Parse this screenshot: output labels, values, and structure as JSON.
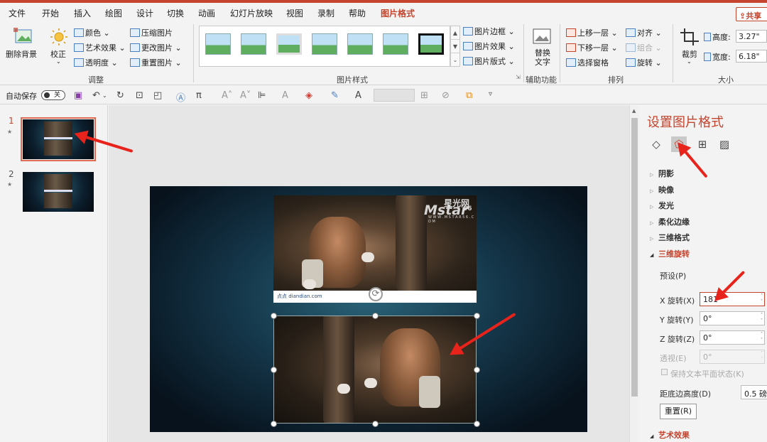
{
  "colors": {
    "accent": "#c4442d",
    "arrow": "#e8231b"
  },
  "menu": {
    "items": [
      "文件",
      "开始",
      "插入",
      "绘图",
      "设计",
      "切换",
      "动画",
      "幻灯片放映",
      "视图",
      "录制",
      "帮助",
      "图片格式"
    ],
    "active": "图片格式",
    "share": "共享"
  },
  "ribbon": {
    "remove_bg": "删除背景",
    "correct": "校正",
    "color": "颜色",
    "artistic": "艺术效果",
    "transparency": "透明度",
    "compress": "压缩图片",
    "change": "更改图片",
    "reset_pic": "重置图片",
    "adjust_label": "调整",
    "styles_label": "图片样式",
    "border": "图片边框",
    "effects": "图片效果",
    "layout": "图片版式",
    "alt_text": "替换文字",
    "accessibility_label": "辅助功能",
    "bring_forward": "上移一层",
    "send_backward": "下移一层",
    "selection_pane": "选择窗格",
    "align": "对齐",
    "group": "组合",
    "rotate": "旋转",
    "arrange_label": "排列",
    "crop": "裁剪",
    "height_label": "高度:",
    "height_value": "3.27\"",
    "width_label": "宽度:",
    "width_value": "6.18\"",
    "size_label": "大小"
  },
  "qat": {
    "autosave": "自动保存",
    "toggle": "关"
  },
  "slides": [
    {
      "number": "1",
      "active": true
    },
    {
      "number": "2",
      "active": false
    }
  ],
  "slide": {
    "watermark_brand": "星光网",
    "watermark_logo": "Mstar",
    "watermark_num": "56",
    "watermark_url": "W W W . M S T A R 5 6 . C O M",
    "band_text": "点点 diandian.com"
  },
  "panel": {
    "title": "设置图片格式",
    "sections": {
      "shadow": "阴影",
      "reflection": "映像",
      "glow": "发光",
      "soft_edges": "柔化边缘",
      "format_3d": "三维格式",
      "rotation_3d": "三维旋转",
      "artistic": "艺术效果"
    },
    "preset": "预设(P)",
    "x_label": "X 旋转(X)",
    "x_value": "181",
    "y_label": "Y 旋转(Y)",
    "y_value": "0°",
    "z_label": "Z 旋转(Z)",
    "z_value": "0°",
    "perspective_label": "透视(E)",
    "perspective_value": "0°",
    "keep_flat": "保持文本平面状态(K)",
    "distance_label": "距底边高度(D)",
    "distance_value": "0.5 磅",
    "reset": "重置(R)"
  }
}
